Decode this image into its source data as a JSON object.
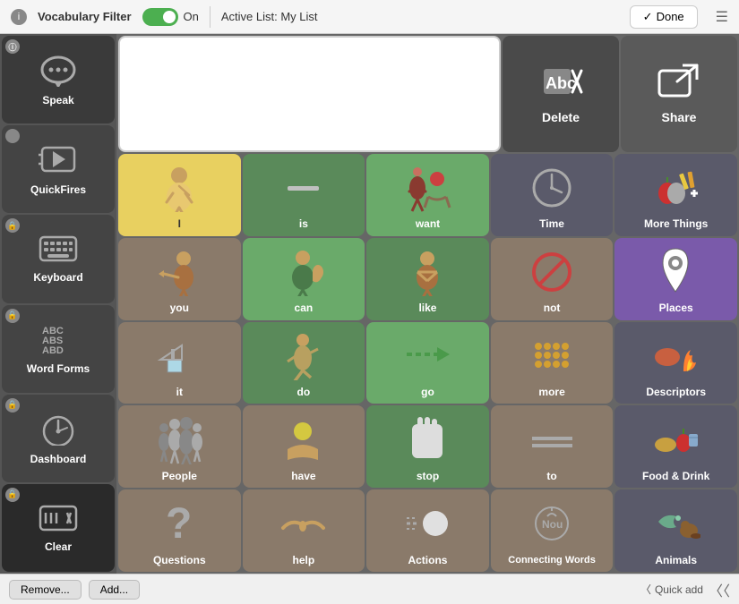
{
  "topBar": {
    "appLabel": "Vocabulary Filter",
    "toggleState": "On",
    "activeList": "Active List: My List",
    "doneLabel": "Done"
  },
  "sidebar": {
    "items": [
      {
        "id": "speak",
        "label": "Speak",
        "icon": "💬"
      },
      {
        "id": "quickfires",
        "label": "QuickFires",
        "icon": "⚡"
      },
      {
        "id": "keyboard",
        "label": "Keyboard",
        "icon": "⌨"
      },
      {
        "id": "wordforms",
        "label": "Word Forms",
        "icon": "🔤"
      },
      {
        "id": "dashboard",
        "label": "Dashboard",
        "icon": "🎛"
      },
      {
        "id": "clear",
        "label": "Clear",
        "icon": "☰✕"
      }
    ]
  },
  "textInput": {
    "placeholder": ""
  },
  "actionButtons": [
    {
      "id": "delete",
      "label": "Delete",
      "icon": "🗑"
    },
    {
      "id": "share",
      "label": "Share",
      "icon": "↗"
    }
  ],
  "grid": {
    "rows": [
      [
        {
          "id": "i",
          "label": "I",
          "color": "yellow",
          "icon": "🧍"
        },
        {
          "id": "is",
          "label": "is",
          "color": "green",
          "icon": "—"
        },
        {
          "id": "want",
          "label": "want",
          "color": "green-light",
          "icon": "🤲"
        },
        {
          "id": "time",
          "label": "Time",
          "color": "tan",
          "icon": "🕐"
        },
        {
          "id": "more-things",
          "label": "More Things",
          "color": "dark",
          "icon": "🍎"
        }
      ],
      [
        {
          "id": "you",
          "label": "you",
          "color": "tan",
          "icon": "👤"
        },
        {
          "id": "can",
          "label": "can",
          "color": "green-light",
          "icon": "💪"
        },
        {
          "id": "like",
          "label": "like",
          "color": "green",
          "icon": "🤜"
        },
        {
          "id": "not",
          "label": "not",
          "color": "tan",
          "icon": "🚫"
        },
        {
          "id": "places",
          "label": "Places",
          "color": "purple",
          "icon": "📍"
        }
      ],
      [
        {
          "id": "it",
          "label": "it",
          "color": "tan",
          "icon": "▶📄"
        },
        {
          "id": "do",
          "label": "do",
          "color": "green",
          "icon": "🏃"
        },
        {
          "id": "go",
          "label": "go",
          "color": "green-light",
          "icon": "➡"
        },
        {
          "id": "more",
          "label": "more",
          "color": "tan",
          "icon": "🟡"
        },
        {
          "id": "descriptors",
          "label": "Descriptors",
          "color": "dark",
          "icon": "🔥"
        }
      ],
      [
        {
          "id": "people",
          "label": "People",
          "color": "tan",
          "icon": "👨‍👩‍👧"
        },
        {
          "id": "have",
          "label": "have",
          "color": "tan",
          "icon": "🤲"
        },
        {
          "id": "stop",
          "label": "stop",
          "color": "green",
          "icon": "✋"
        },
        {
          "id": "to",
          "label": "to",
          "color": "tan",
          "icon": "〰"
        },
        {
          "id": "food-drink",
          "label": "Food & Drink",
          "color": "dark",
          "icon": "🍞"
        }
      ],
      [
        {
          "id": "questions",
          "label": "Questions",
          "color": "tan",
          "icon": "❓"
        },
        {
          "id": "help",
          "label": "help",
          "color": "tan",
          "icon": "🤝"
        },
        {
          "id": "actions",
          "label": "Actions",
          "color": "tan",
          "icon": "⚪"
        },
        {
          "id": "connecting-words",
          "label": "Connecting Words",
          "color": "tan",
          "icon": "◉"
        },
        {
          "id": "animals",
          "label": "Animals",
          "color": "dark",
          "icon": "🐦"
        }
      ]
    ]
  },
  "bottomBar": {
    "removeLabel": "Remove...",
    "addLabel": "Add...",
    "quickAddLabel": "Quick add"
  }
}
